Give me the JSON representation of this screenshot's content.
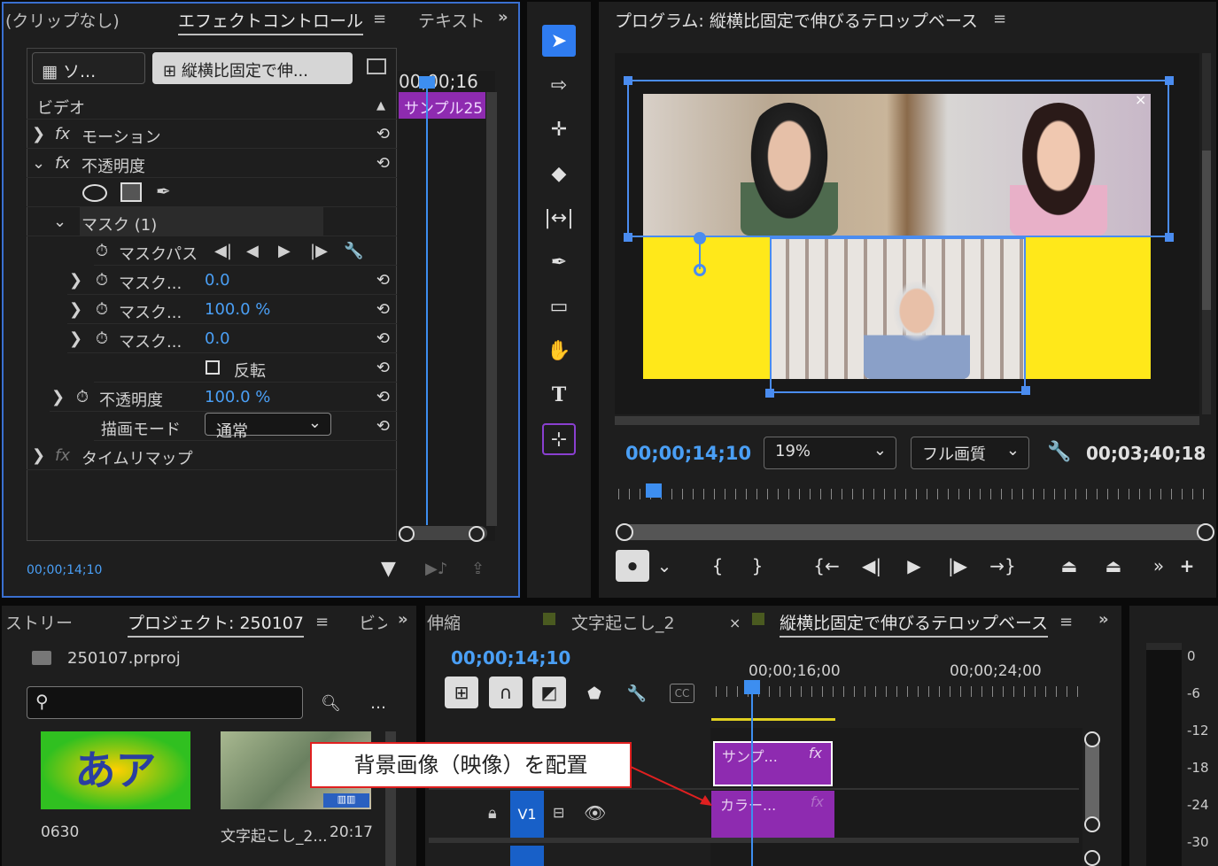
{
  "effect_panel": {
    "tabs": [
      "(クリップなし)",
      "エフェクトコントロール",
      "テキスト"
    ],
    "source_btn": "ソ...",
    "seq_btn": "縦横比固定で伸...",
    "timecode_head": "00;00;16",
    "clip_label": "サンプル25",
    "video_header": "ビデオ",
    "motion": "モーション",
    "opacity": "不透明度",
    "mask": "マスク (1)",
    "mask_path": "マスクパス",
    "mask_feather_label": "マスク...",
    "mask_feather": "0.0",
    "mask_opacity_label": "マスク...",
    "mask_opacity": "100.0 %",
    "mask_expand_label": "マスク...",
    "mask_expand": "0.0",
    "invert": "反転",
    "opacity2": "不透明度",
    "opacity_value": "100.0 %",
    "blend_label": "描画モード",
    "blend_value": "通常",
    "time_remap": "タイムリマップ",
    "timecode": "00;00;14;10"
  },
  "program": {
    "title": "プログラム: 縦横比固定で伸びるテロップベース",
    "timecode": "00;00;14;10",
    "zoom": "19%",
    "quality": "フル画質",
    "duration": "00;03;40;18"
  },
  "project": {
    "tabs": [
      "ストリー",
      "プロジェクト: 250107",
      "ビン"
    ],
    "file": "250107.prproj",
    "search_placeholder": "",
    "thumb1_text": "あア",
    "thumb1_label": "0630",
    "thumb2_label": "文字起こし_2...",
    "thumb2_duration": "20:17"
  },
  "timeline": {
    "tabs": [
      "伸縮",
      "文字起こし_2",
      "縦横比固定で伸びるテロップベース"
    ],
    "close": "×",
    "timecode": "00;00;14;10",
    "ruler1": "00;00;16;00",
    "ruler2": "00;00;24;00",
    "clip1": "サンプ...",
    "clip2": "カラー...",
    "fx": "fx",
    "track": "V1"
  },
  "annotation": "背景画像（映像）を配置",
  "meter": {
    "labels": [
      "0",
      "-6",
      "-12",
      "-18",
      "-24",
      "-30"
    ]
  }
}
